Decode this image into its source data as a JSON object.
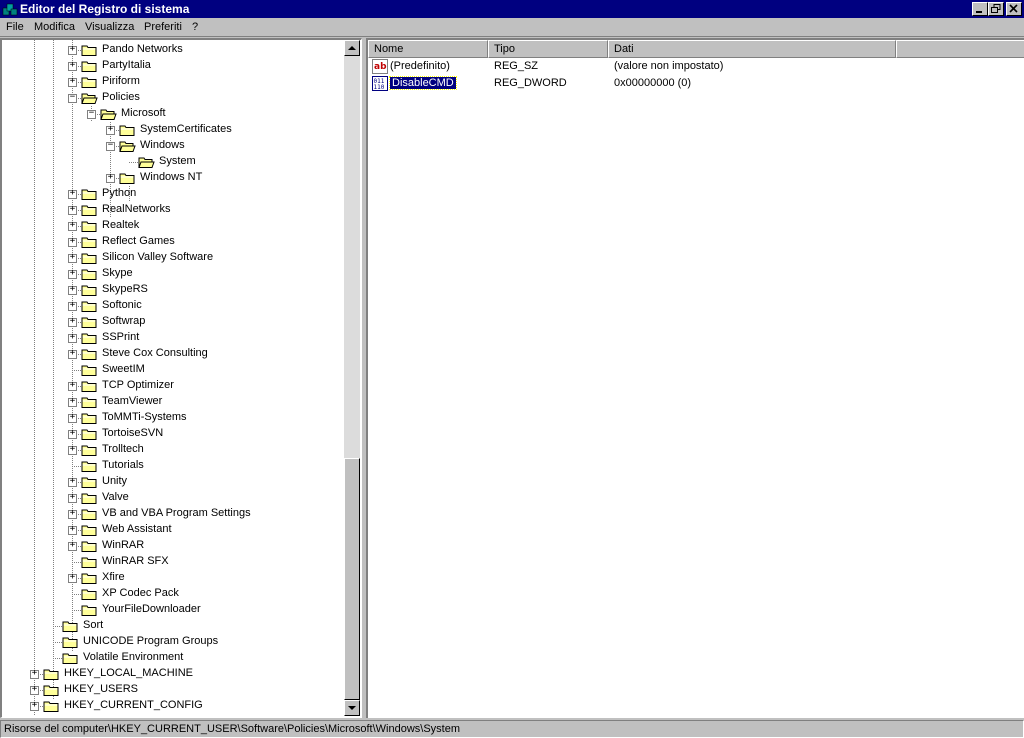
{
  "window": {
    "title": "Editor del Registro di sistema",
    "title_bar_color": "#000080",
    "buttons": [
      "minimize-icon",
      "restore-icon",
      "close-icon"
    ]
  },
  "menu": {
    "items": [
      "File",
      "Modifica",
      "Visualizza",
      "Preferiti",
      "?"
    ]
  },
  "tree": {
    "folder_color": "#ffff99",
    "items": [
      {
        "label": "Pando Networks",
        "expander": "+"
      },
      {
        "label": "PartyItalia",
        "expander": "+"
      },
      {
        "label": "Piriform",
        "expander": "+"
      },
      {
        "label": "Policies",
        "expander": "-"
      },
      {
        "label": "Microsoft",
        "expander": "-"
      },
      {
        "label": "SystemCertificates",
        "expander": "+"
      },
      {
        "label": "Windows",
        "expander": "-"
      },
      {
        "label": "System",
        "expander": ""
      },
      {
        "label": "Windows NT",
        "expander": "+"
      },
      {
        "label": "Python",
        "expander": "+"
      },
      {
        "label": "RealNetworks",
        "expander": "+"
      },
      {
        "label": "Realtek",
        "expander": "+"
      },
      {
        "label": "Reflect Games",
        "expander": "+"
      },
      {
        "label": "Silicon Valley Software",
        "expander": "+"
      },
      {
        "label": "Skype",
        "expander": "+"
      },
      {
        "label": "SkypeRS",
        "expander": "+"
      },
      {
        "label": "Softonic",
        "expander": "+"
      },
      {
        "label": "Softwrap",
        "expander": "+"
      },
      {
        "label": "SSPrint",
        "expander": "+"
      },
      {
        "label": "Steve Cox Consulting",
        "expander": "+"
      },
      {
        "label": "SweetIM",
        "expander": ""
      },
      {
        "label": "TCP Optimizer",
        "expander": "+"
      },
      {
        "label": "TeamViewer",
        "expander": "+"
      },
      {
        "label": "ToMMTi-Systems",
        "expander": "+"
      },
      {
        "label": "TortoiseSVN",
        "expander": "+"
      },
      {
        "label": "Trolltech",
        "expander": "+"
      },
      {
        "label": "Tutorials",
        "expander": ""
      },
      {
        "label": "Unity",
        "expander": "+"
      },
      {
        "label": "Valve",
        "expander": "+"
      },
      {
        "label": "VB and VBA Program Settings",
        "expander": "+"
      },
      {
        "label": "Web Assistant",
        "expander": "+"
      },
      {
        "label": "WinRAR",
        "expander": "+"
      },
      {
        "label": "WinRAR SFX",
        "expander": ""
      },
      {
        "label": "Xfire",
        "expander": "+"
      },
      {
        "label": "XP Codec Pack",
        "expander": ""
      },
      {
        "label": "YourFileDownloader",
        "expander": ""
      },
      {
        "label": "Sort",
        "expander": ""
      },
      {
        "label": "UNICODE Program Groups",
        "expander": ""
      },
      {
        "label": "Volatile Environment",
        "expander": ""
      },
      {
        "label": "HKEY_LOCAL_MACHINE",
        "expander": "+"
      },
      {
        "label": "HKEY_USERS",
        "expander": "+"
      },
      {
        "label": "HKEY_CURRENT_CONFIG",
        "expander": "+"
      }
    ]
  },
  "list": {
    "columns": [
      "Nome",
      "Tipo",
      "Dati"
    ],
    "rows": [
      {
        "icon": "string-value-icon",
        "name": "(Predefinito)",
        "type": "REG_SZ",
        "data": "(valore non impostato)"
      },
      {
        "icon": "binary-value-icon",
        "name": "DisableCMD",
        "type": "REG_DWORD",
        "data": "0x00000000 (0)",
        "selected": true
      }
    ]
  },
  "status": {
    "path": "Risorse del computer\\HKEY_CURRENT_USER\\Software\\Policies\\Microsoft\\Windows\\System"
  }
}
